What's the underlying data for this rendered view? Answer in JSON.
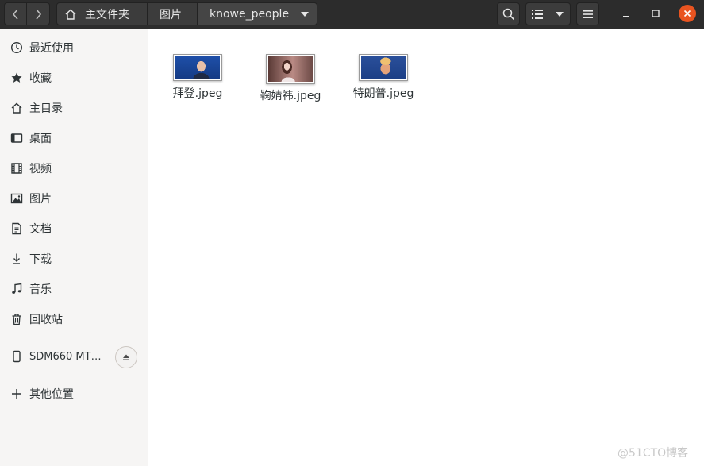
{
  "header": {
    "breadcrumbs": [
      {
        "label": "主文件夹",
        "icon": "home-icon"
      },
      {
        "label": "图片"
      },
      {
        "label": "knowe_people",
        "current": true
      }
    ]
  },
  "sidebar": {
    "items": [
      {
        "label": "最近使用",
        "icon": "recent-icon"
      },
      {
        "label": "收藏",
        "icon": "star-icon"
      },
      {
        "label": "主目录",
        "icon": "home-icon"
      },
      {
        "label": "桌面",
        "icon": "desktop-icon"
      },
      {
        "label": "视频",
        "icon": "video-icon"
      },
      {
        "label": "图片",
        "icon": "picture-icon"
      },
      {
        "label": "文档",
        "icon": "document-icon"
      },
      {
        "label": "下载",
        "icon": "download-icon"
      },
      {
        "label": "音乐",
        "icon": "music-icon"
      },
      {
        "label": "回收站",
        "icon": "trash-icon"
      }
    ],
    "device": {
      "label": "SDM660 MT…",
      "icon": "phone-icon"
    },
    "other": {
      "label": "其他位置",
      "icon": "plus-icon"
    }
  },
  "files": [
    {
      "name": "拜登.jpeg"
    },
    {
      "name": "鞠婧祎.jpeg"
    },
    {
      "name": "特朗普.jpeg"
    }
  ],
  "watermark": "@51CTO博客",
  "colors": {
    "headerbar": "#2c2c2c",
    "close": "#e95420",
    "sidebar": "#f6f5f4"
  }
}
